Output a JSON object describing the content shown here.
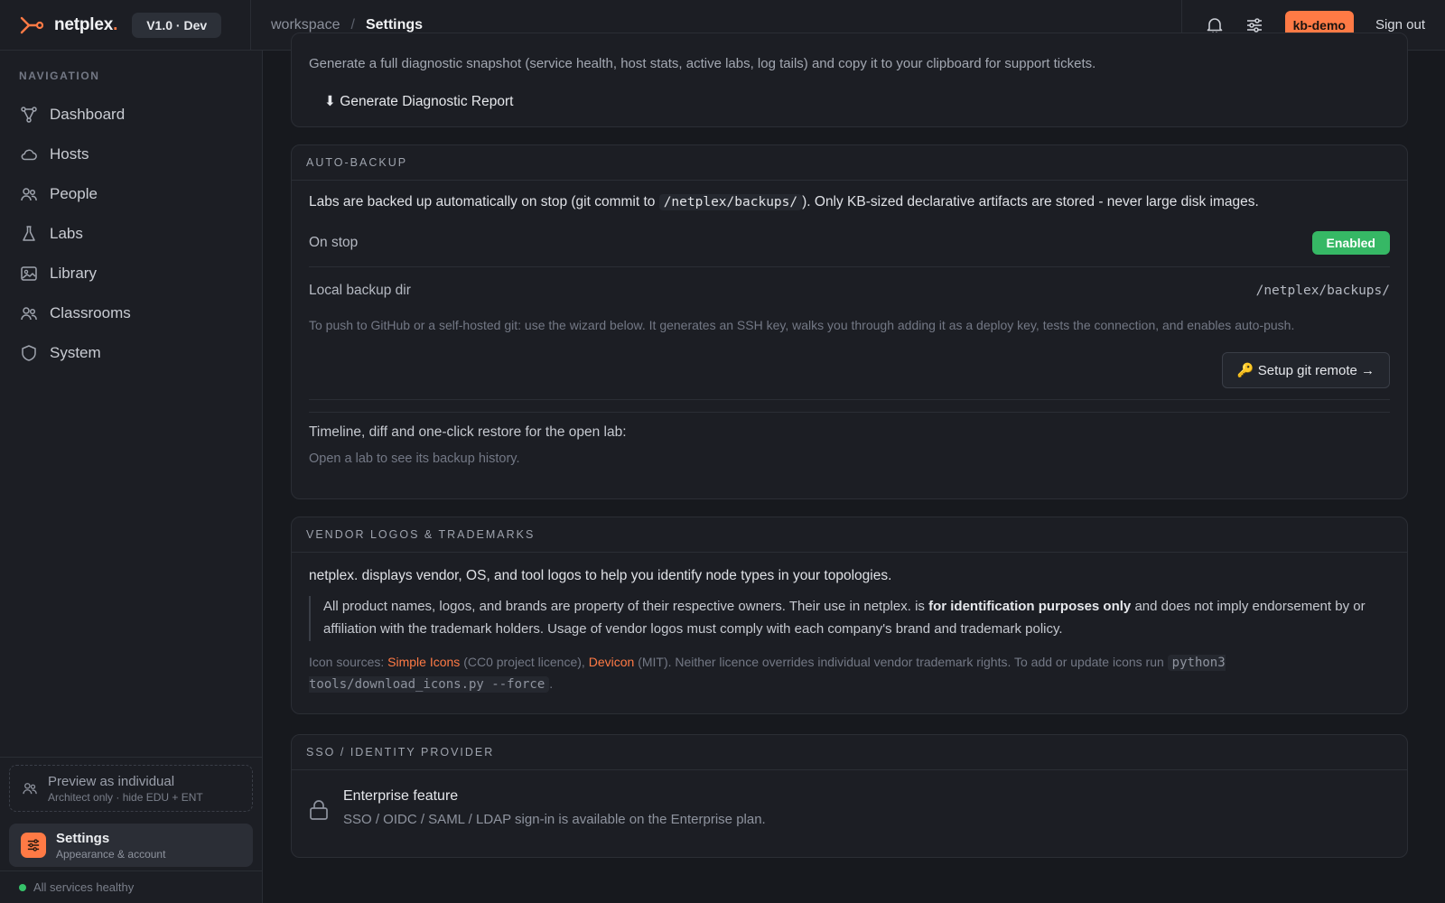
{
  "app": {
    "brand_name": "netplex",
    "brand_dot": ".",
    "version": "V1.0 · Dev"
  },
  "breadcrumb": {
    "root": "workspace",
    "separator": "/",
    "current": "Settings"
  },
  "header": {
    "user_chip": "kb-demo",
    "sign_out": "Sign out",
    "accent_color": "#ff7a45"
  },
  "sidebar": {
    "heading": "NAVIGATION",
    "items": [
      {
        "label": "Dashboard",
        "icon": "topology-icon"
      },
      {
        "label": "Hosts",
        "icon": "cloud-icon"
      },
      {
        "label": "People",
        "icon": "people-icon"
      },
      {
        "label": "Labs",
        "icon": "flask-icon"
      },
      {
        "label": "Library",
        "icon": "image-icon"
      },
      {
        "label": "Classrooms",
        "icon": "people-icon"
      },
      {
        "label": "System",
        "icon": "shield-icon"
      }
    ],
    "preview": {
      "title": "Preview as individual",
      "subtitle": "Architect only · hide EDU + ENT"
    },
    "settings": {
      "title": "Settings",
      "subtitle": "Appearance & account"
    },
    "health": "All services healthy"
  },
  "diagnostics": {
    "description": "Generate a full diagnostic snapshot (service health, host stats, active labs, log tails) and copy it to your clipboard for support tickets.",
    "button": "⬇ Generate Diagnostic Report"
  },
  "auto_backup": {
    "title": "AUTO-BACKUP",
    "desc_before": "Labs are backed up automatically on stop (git commit to",
    "desc_code": "/netplex/backups/",
    "desc_after": "). Only KB-sized declarative artifacts are stored - never large disk images.",
    "on_stop_label": "On stop",
    "on_stop_value": "Enabled",
    "local_dir_label": "Local backup dir",
    "local_dir_value": "/netplex/backups/",
    "hint": "To push to GitHub or a self-hosted git: use the wizard below. It generates an SSH key, walks you through adding it as a deploy key, tests the connection, and enables auto-push.",
    "setup_button": "🔑 Setup git remote →",
    "timeline_label": "Timeline, diff and one-click restore for the open lab:",
    "timeline_empty": "Open a lab to see its backup history."
  },
  "vendor_logos": {
    "title": "VENDOR LOGOS & TRADEMARKS",
    "intro": "netplex. displays vendor, OS, and tool logos to help you identify node types in your topologies.",
    "quote_before": "All product names, logos, and brands are property of their respective owners. Their use in netplex. is",
    "quote_bold": "for identification purposes only",
    "quote_after": "and does not imply endorsement by or affiliation with the trademark holders. Usage of vendor logos must comply with each company's brand and trademark policy.",
    "sources_prefix": "Icon sources:",
    "source1_name": "Simple Icons",
    "source1_licence": "(CC0 project licence),",
    "source2_name": "Devicon",
    "source2_licence": "(MIT). Neither licence overrides individual vendor trademark rights. To add or update icons run",
    "command": "python3 tools/download_icons.py --force",
    "sources_suffix": "."
  },
  "sso": {
    "title": "SSO / IDENTITY PROVIDER",
    "feature_title": "Enterprise feature",
    "feature_desc": "SSO / OIDC / SAML / LDAP sign-in is available on the Enterprise plan."
  }
}
